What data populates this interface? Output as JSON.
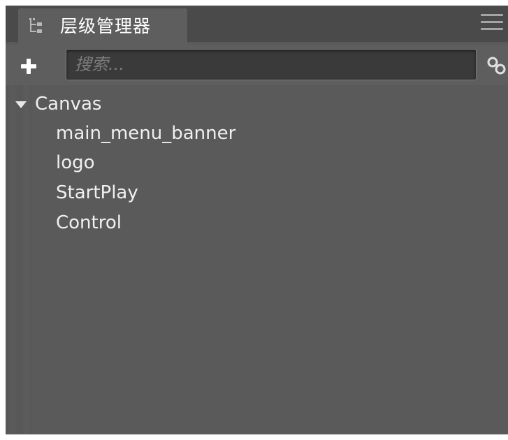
{
  "panel": {
    "title": "层级管理器"
  },
  "toolbar": {
    "add_icon": "plus-icon",
    "search_placeholder": "搜索...",
    "search_value": "",
    "link_icon": "link-icon"
  },
  "tree": {
    "root": {
      "label": "Canvas",
      "expanded": true
    },
    "children": [
      {
        "label": "main_menu_banner"
      },
      {
        "label": "logo"
      },
      {
        "label": "StartPlay"
      },
      {
        "label": "Control"
      }
    ]
  },
  "colors": {
    "panel_bg": "#5a5a5a",
    "tab_bg": "#5e5e5e",
    "tabbar_bg": "#4a4a4a",
    "search_bg": "#3a3a3a",
    "text": "#f0f0f0"
  }
}
